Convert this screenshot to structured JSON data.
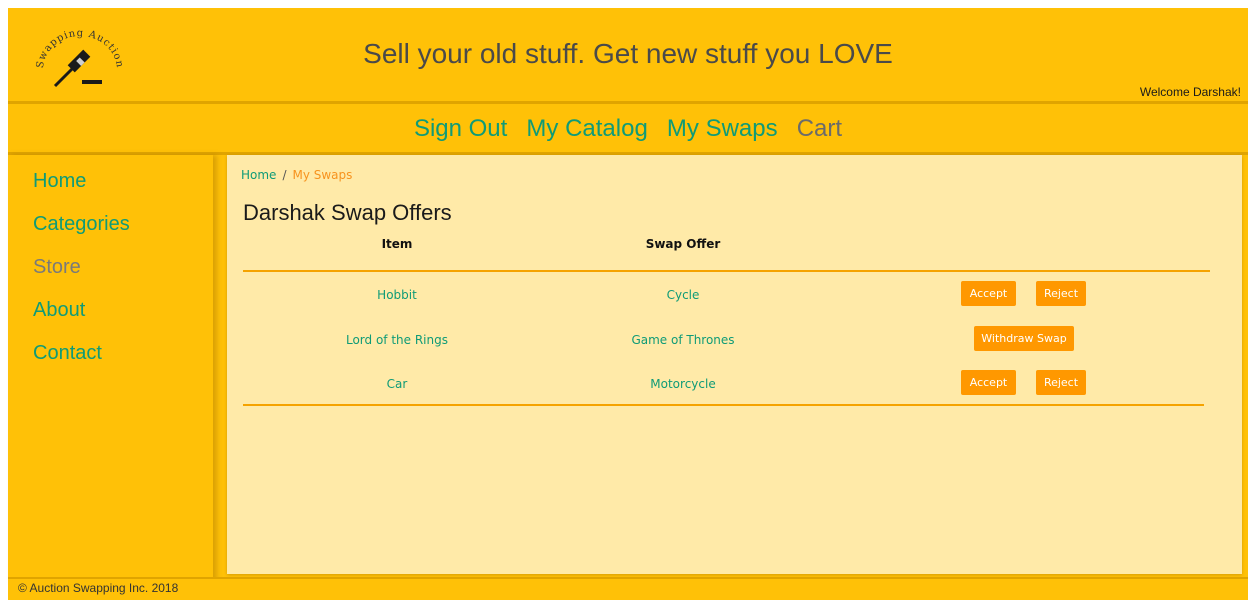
{
  "header": {
    "logo_text": "Swapping Auction",
    "tagline": "Sell your old stuff. Get new stuff you LOVE",
    "welcome": "Welcome Darshak!"
  },
  "nav": {
    "items": [
      {
        "label": "Sign Out"
      },
      {
        "label": "My Catalog"
      },
      {
        "label": "My Swaps"
      },
      {
        "label": "Cart"
      }
    ]
  },
  "sidebar": {
    "items": [
      {
        "label": "Home"
      },
      {
        "label": "Categories"
      },
      {
        "label": "Store"
      },
      {
        "label": "About"
      },
      {
        "label": "Contact"
      }
    ]
  },
  "breadcrumb": {
    "home": "Home",
    "separator": "/",
    "current": "My Swaps"
  },
  "page": {
    "title": "Darshak Swap Offers"
  },
  "table": {
    "headers": [
      "Item",
      "Swap Offer"
    ],
    "rows": [
      {
        "item": "Hobbit",
        "offer": "Cycle",
        "actions": [
          "Accept",
          "Reject"
        ]
      },
      {
        "item": "Lord of the Rings",
        "offer": "Game of Thrones",
        "actions": [
          "Withdraw Swap"
        ]
      },
      {
        "item": "Car",
        "offer": "Motorcycle",
        "actions": [
          "Accept",
          "Reject"
        ]
      }
    ]
  },
  "footer": {
    "copyright": "© Auction Swapping Inc. 2018"
  },
  "colors": {
    "primary": "#ffc107",
    "content_bg": "#ffeaa8",
    "link": "#0f9b77",
    "button": "#ff9800"
  }
}
